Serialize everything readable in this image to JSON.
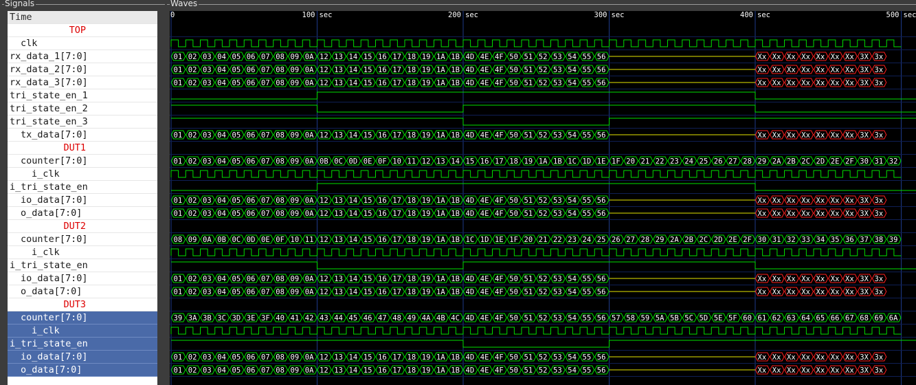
{
  "signals_panel": {
    "title": "Signals",
    "time_label": "Time"
  },
  "waves_panel": {
    "title": "Waves"
  },
  "time_axis": {
    "unit": "sec",
    "ticks": [
      {
        "label": "0"
      },
      {
        "label": "100",
        "unit": "sec"
      },
      {
        "label": "200",
        "unit": "sec"
      },
      {
        "label": "300",
        "unit": "sec"
      },
      {
        "label": "400",
        "unit": "sec"
      },
      {
        "label": "500",
        "unit": "sec"
      }
    ]
  },
  "signals": [
    {
      "name": "TOP",
      "kind": "group"
    },
    {
      "name": "clk",
      "kind": "clock",
      "indent": 1
    },
    {
      "name": "rx_data_1[7:0]",
      "kind": "bus",
      "bus": "A"
    },
    {
      "name": "rx_data_2[7:0]",
      "kind": "bus",
      "bus": "A"
    },
    {
      "name": "rx_data_3[7:0]",
      "kind": "bus",
      "bus": "A"
    },
    {
      "name": "tri_state_en_1",
      "kind": "bit",
      "edges": [
        [
          0,
          0
        ],
        [
          10,
          1
        ],
        [
          40,
          0
        ]
      ]
    },
    {
      "name": "tri_state_en_2",
      "kind": "bit",
      "edges": [
        [
          0,
          1
        ],
        [
          10,
          0
        ],
        [
          20,
          1
        ],
        [
          40,
          0
        ]
      ]
    },
    {
      "name": "tri_state_en_3",
      "kind": "bit",
      "edges": [
        [
          0,
          1
        ],
        [
          20,
          0
        ],
        [
          30,
          1
        ]
      ]
    },
    {
      "name": "tx_data[7:0]",
      "kind": "bus",
      "bus": "A",
      "indent": 1
    },
    {
      "name": "DUT1",
      "kind": "group"
    },
    {
      "name": "counter[7:0]",
      "kind": "bus",
      "bus": "C1",
      "indent": 1
    },
    {
      "name": "i_clk",
      "kind": "clock",
      "indent": 2
    },
    {
      "name": "i_tri_state_en",
      "kind": "bit",
      "edges": [
        [
          0,
          0
        ],
        [
          10,
          1
        ],
        [
          40,
          0
        ]
      ]
    },
    {
      "name": "io_data[7:0]",
      "kind": "bus",
      "bus": "A",
      "indent": 1
    },
    {
      "name": "o_data[7:0]",
      "kind": "bus",
      "bus": "A",
      "indent": 1
    },
    {
      "name": "DUT2",
      "kind": "group"
    },
    {
      "name": "counter[7:0]",
      "kind": "bus",
      "bus": "C2",
      "indent": 1
    },
    {
      "name": "i_clk",
      "kind": "clock",
      "indent": 2
    },
    {
      "name": "i_tri_state_en",
      "kind": "bit",
      "edges": [
        [
          0,
          1
        ],
        [
          10,
          0
        ],
        [
          20,
          1
        ],
        [
          40,
          0
        ]
      ]
    },
    {
      "name": "io_data[7:0]",
      "kind": "bus",
      "bus": "A",
      "indent": 1
    },
    {
      "name": "o_data[7:0]",
      "kind": "bus",
      "bus": "A",
      "indent": 1
    },
    {
      "name": "DUT3",
      "kind": "group"
    },
    {
      "name": "counter[7:0]",
      "kind": "bus",
      "bus": "C3",
      "indent": 1,
      "selected": true
    },
    {
      "name": "i_clk",
      "kind": "clock",
      "indent": 2,
      "selected": true
    },
    {
      "name": "i_tri_state_en",
      "kind": "bit",
      "edges": [
        [
          0,
          1
        ],
        [
          20,
          0
        ],
        [
          30,
          1
        ]
      ],
      "selected": true
    },
    {
      "name": "io_data[7:0]",
      "kind": "bus",
      "bus": "A",
      "indent": 1,
      "selected": true
    },
    {
      "name": "o_data[7:0]",
      "kind": "bus",
      "bus": "A",
      "indent": 1,
      "selected": true
    }
  ],
  "bus_values": {
    "A": {
      "segments": [
        "01",
        "02",
        "03",
        "04",
        "05",
        "06",
        "07",
        "08",
        "09",
        "0A",
        "12",
        "13",
        "14",
        "15",
        "16",
        "17",
        "18",
        "19",
        "1A",
        "1B",
        "4D",
        "4E",
        "4F",
        "50",
        "51",
        "52",
        "53",
        "54",
        "55",
        "56"
      ],
      "x_values": [
        "Xx",
        "Xx",
        "Xx",
        "Xx",
        "Xx",
        "Xx",
        "Xx",
        "3X",
        "3x"
      ]
    },
    "C1": [
      "01",
      "02",
      "03",
      "04",
      "05",
      "06",
      "07",
      "08",
      "09",
      "0A",
      "0B",
      "0C",
      "0D",
      "0E",
      "0F",
      "10",
      "11",
      "12",
      "13",
      "14",
      "15",
      "16",
      "17",
      "18",
      "19",
      "1A",
      "1B",
      "1C",
      "1D",
      "1E",
      "1F",
      "20",
      "21",
      "22",
      "23",
      "24",
      "25",
      "26",
      "27",
      "28",
      "29",
      "2A",
      "2B",
      "2C",
      "2D",
      "2E",
      "2F",
      "30",
      "31",
      "32"
    ],
    "C2": [
      "08",
      "09",
      "0A",
      "0B",
      "0C",
      "0D",
      "0E",
      "0F",
      "10",
      "11",
      "12",
      "13",
      "14",
      "15",
      "16",
      "17",
      "18",
      "19",
      "1A",
      "1B",
      "1C",
      "1D",
      "1E",
      "1F",
      "20",
      "21",
      "22",
      "23",
      "24",
      "25",
      "26",
      "27",
      "28",
      "29",
      "2A",
      "2B",
      "2C",
      "2D",
      "2E",
      "2F",
      "30",
      "31",
      "32",
      "33",
      "34",
      "35",
      "36",
      "37",
      "38",
      "39"
    ],
    "C3": [
      "39",
      "3A",
      "3B",
      "3C",
      "3D",
      "3E",
      "3F",
      "40",
      "41",
      "42",
      "43",
      "44",
      "45",
      "46",
      "47",
      "48",
      "49",
      "4A",
      "4B",
      "4C",
      "4D",
      "4E",
      "4F",
      "50",
      "51",
      "52",
      "53",
      "54",
      "55",
      "56",
      "57",
      "58",
      "59",
      "5A",
      "5B",
      "5C",
      "5D",
      "5E",
      "5F",
      "60",
      "61",
      "62",
      "63",
      "64",
      "65",
      "66",
      "67",
      "68",
      "69",
      "6A"
    ]
  },
  "colors": {
    "wave": "#00e000",
    "wave_text": "#ffffff",
    "z_state": "#e6e600",
    "x_state": "#ff2020",
    "grid": "#1e3a8a",
    "wave_bg": "#000000",
    "axis_text": "#ffffff",
    "group_label": "#dd0000",
    "selection": "#4a6aa8"
  }
}
